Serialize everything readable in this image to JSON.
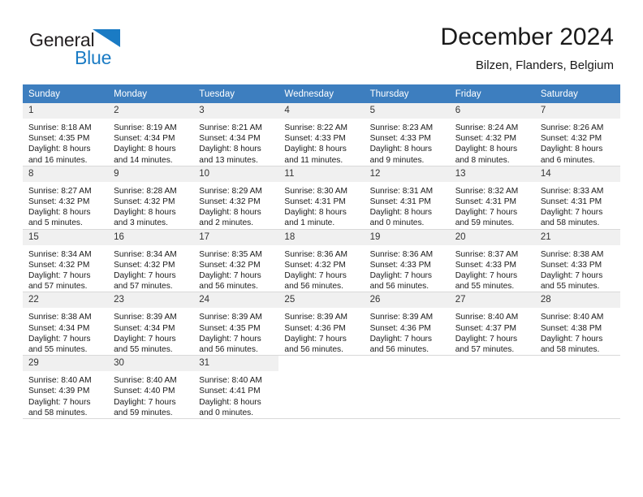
{
  "brand": {
    "name_part1": "General",
    "name_part2": "Blue",
    "mark_icon": "triangle-logo-icon",
    "accent_color": "#1a7bc4"
  },
  "header": {
    "title": "December 2024",
    "subtitle": "Bilzen, Flanders, Belgium"
  },
  "colors": {
    "header_row": "#3d7ebf",
    "daynum_band": "#f0f0f0",
    "grid_line": "#d9d9d9"
  },
  "weekday_headers": [
    "Sunday",
    "Monday",
    "Tuesday",
    "Wednesday",
    "Thursday",
    "Friday",
    "Saturday"
  ],
  "weeks": [
    [
      {
        "day": "1",
        "sunrise": "Sunrise: 8:18 AM",
        "sunset": "Sunset: 4:35 PM",
        "daylight1": "Daylight: 8 hours",
        "daylight2": "and 16 minutes."
      },
      {
        "day": "2",
        "sunrise": "Sunrise: 8:19 AM",
        "sunset": "Sunset: 4:34 PM",
        "daylight1": "Daylight: 8 hours",
        "daylight2": "and 14 minutes."
      },
      {
        "day": "3",
        "sunrise": "Sunrise: 8:21 AM",
        "sunset": "Sunset: 4:34 PM",
        "daylight1": "Daylight: 8 hours",
        "daylight2": "and 13 minutes."
      },
      {
        "day": "4",
        "sunrise": "Sunrise: 8:22 AM",
        "sunset": "Sunset: 4:33 PM",
        "daylight1": "Daylight: 8 hours",
        "daylight2": "and 11 minutes."
      },
      {
        "day": "5",
        "sunrise": "Sunrise: 8:23 AM",
        "sunset": "Sunset: 4:33 PM",
        "daylight1": "Daylight: 8 hours",
        "daylight2": "and 9 minutes."
      },
      {
        "day": "6",
        "sunrise": "Sunrise: 8:24 AM",
        "sunset": "Sunset: 4:32 PM",
        "daylight1": "Daylight: 8 hours",
        "daylight2": "and 8 minutes."
      },
      {
        "day": "7",
        "sunrise": "Sunrise: 8:26 AM",
        "sunset": "Sunset: 4:32 PM",
        "daylight1": "Daylight: 8 hours",
        "daylight2": "and 6 minutes."
      }
    ],
    [
      {
        "day": "8",
        "sunrise": "Sunrise: 8:27 AM",
        "sunset": "Sunset: 4:32 PM",
        "daylight1": "Daylight: 8 hours",
        "daylight2": "and 5 minutes."
      },
      {
        "day": "9",
        "sunrise": "Sunrise: 8:28 AM",
        "sunset": "Sunset: 4:32 PM",
        "daylight1": "Daylight: 8 hours",
        "daylight2": "and 3 minutes."
      },
      {
        "day": "10",
        "sunrise": "Sunrise: 8:29 AM",
        "sunset": "Sunset: 4:32 PM",
        "daylight1": "Daylight: 8 hours",
        "daylight2": "and 2 minutes."
      },
      {
        "day": "11",
        "sunrise": "Sunrise: 8:30 AM",
        "sunset": "Sunset: 4:31 PM",
        "daylight1": "Daylight: 8 hours",
        "daylight2": "and 1 minute."
      },
      {
        "day": "12",
        "sunrise": "Sunrise: 8:31 AM",
        "sunset": "Sunset: 4:31 PM",
        "daylight1": "Daylight: 8 hours",
        "daylight2": "and 0 minutes."
      },
      {
        "day": "13",
        "sunrise": "Sunrise: 8:32 AM",
        "sunset": "Sunset: 4:31 PM",
        "daylight1": "Daylight: 7 hours",
        "daylight2": "and 59 minutes."
      },
      {
        "day": "14",
        "sunrise": "Sunrise: 8:33 AM",
        "sunset": "Sunset: 4:31 PM",
        "daylight1": "Daylight: 7 hours",
        "daylight2": "and 58 minutes."
      }
    ],
    [
      {
        "day": "15",
        "sunrise": "Sunrise: 8:34 AM",
        "sunset": "Sunset: 4:32 PM",
        "daylight1": "Daylight: 7 hours",
        "daylight2": "and 57 minutes."
      },
      {
        "day": "16",
        "sunrise": "Sunrise: 8:34 AM",
        "sunset": "Sunset: 4:32 PM",
        "daylight1": "Daylight: 7 hours",
        "daylight2": "and 57 minutes."
      },
      {
        "day": "17",
        "sunrise": "Sunrise: 8:35 AM",
        "sunset": "Sunset: 4:32 PM",
        "daylight1": "Daylight: 7 hours",
        "daylight2": "and 56 minutes."
      },
      {
        "day": "18",
        "sunrise": "Sunrise: 8:36 AM",
        "sunset": "Sunset: 4:32 PM",
        "daylight1": "Daylight: 7 hours",
        "daylight2": "and 56 minutes."
      },
      {
        "day": "19",
        "sunrise": "Sunrise: 8:36 AM",
        "sunset": "Sunset: 4:33 PM",
        "daylight1": "Daylight: 7 hours",
        "daylight2": "and 56 minutes."
      },
      {
        "day": "20",
        "sunrise": "Sunrise: 8:37 AM",
        "sunset": "Sunset: 4:33 PM",
        "daylight1": "Daylight: 7 hours",
        "daylight2": "and 55 minutes."
      },
      {
        "day": "21",
        "sunrise": "Sunrise: 8:38 AM",
        "sunset": "Sunset: 4:33 PM",
        "daylight1": "Daylight: 7 hours",
        "daylight2": "and 55 minutes."
      }
    ],
    [
      {
        "day": "22",
        "sunrise": "Sunrise: 8:38 AM",
        "sunset": "Sunset: 4:34 PM",
        "daylight1": "Daylight: 7 hours",
        "daylight2": "and 55 minutes."
      },
      {
        "day": "23",
        "sunrise": "Sunrise: 8:39 AM",
        "sunset": "Sunset: 4:34 PM",
        "daylight1": "Daylight: 7 hours",
        "daylight2": "and 55 minutes."
      },
      {
        "day": "24",
        "sunrise": "Sunrise: 8:39 AM",
        "sunset": "Sunset: 4:35 PM",
        "daylight1": "Daylight: 7 hours",
        "daylight2": "and 56 minutes."
      },
      {
        "day": "25",
        "sunrise": "Sunrise: 8:39 AM",
        "sunset": "Sunset: 4:36 PM",
        "daylight1": "Daylight: 7 hours",
        "daylight2": "and 56 minutes."
      },
      {
        "day": "26",
        "sunrise": "Sunrise: 8:39 AM",
        "sunset": "Sunset: 4:36 PM",
        "daylight1": "Daylight: 7 hours",
        "daylight2": "and 56 minutes."
      },
      {
        "day": "27",
        "sunrise": "Sunrise: 8:40 AM",
        "sunset": "Sunset: 4:37 PM",
        "daylight1": "Daylight: 7 hours",
        "daylight2": "and 57 minutes."
      },
      {
        "day": "28",
        "sunrise": "Sunrise: 8:40 AM",
        "sunset": "Sunset: 4:38 PM",
        "daylight1": "Daylight: 7 hours",
        "daylight2": "and 58 minutes."
      }
    ],
    [
      {
        "day": "29",
        "sunrise": "Sunrise: 8:40 AM",
        "sunset": "Sunset: 4:39 PM",
        "daylight1": "Daylight: 7 hours",
        "daylight2": "and 58 minutes."
      },
      {
        "day": "30",
        "sunrise": "Sunrise: 8:40 AM",
        "sunset": "Sunset: 4:40 PM",
        "daylight1": "Daylight: 7 hours",
        "daylight2": "and 59 minutes."
      },
      {
        "day": "31",
        "sunrise": "Sunrise: 8:40 AM",
        "sunset": "Sunset: 4:41 PM",
        "daylight1": "Daylight: 8 hours",
        "daylight2": "and 0 minutes."
      },
      {
        "day": "",
        "sunrise": "",
        "sunset": "",
        "daylight1": "",
        "daylight2": ""
      },
      {
        "day": "",
        "sunrise": "",
        "sunset": "",
        "daylight1": "",
        "daylight2": ""
      },
      {
        "day": "",
        "sunrise": "",
        "sunset": "",
        "daylight1": "",
        "daylight2": ""
      },
      {
        "day": "",
        "sunrise": "",
        "sunset": "",
        "daylight1": "",
        "daylight2": ""
      }
    ]
  ]
}
